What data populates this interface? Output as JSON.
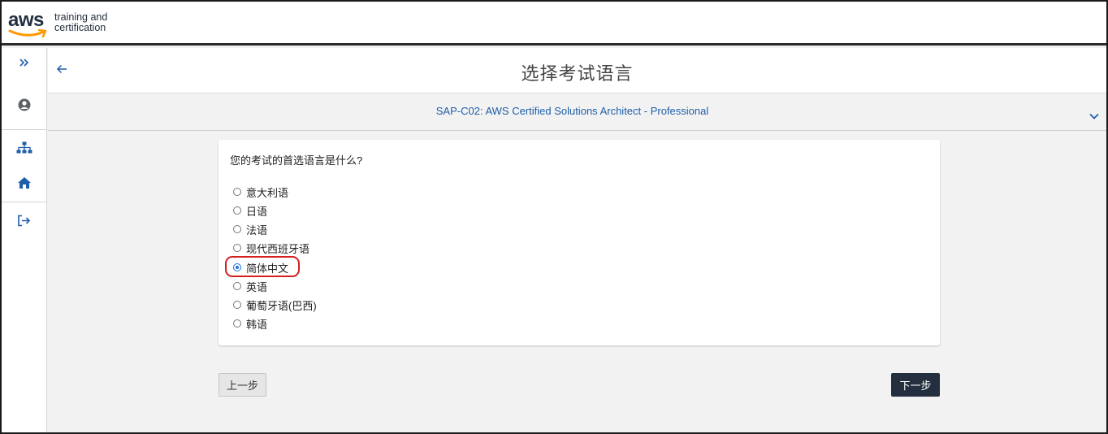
{
  "brand": {
    "logo_word": "aws",
    "logo_line1": "training and",
    "logo_line2": "certification"
  },
  "sidebar": {
    "items": [
      {
        "icon": "double-chevron-right-icon"
      },
      {
        "icon": "user-circle-icon"
      },
      {
        "icon": "sitemap-icon"
      },
      {
        "icon": "home-icon"
      },
      {
        "icon": "sign-out-icon"
      }
    ]
  },
  "header": {
    "title": "选择考试语言",
    "back_icon": "arrow-left-icon"
  },
  "exam": {
    "name": "SAP-C02: AWS Certified Solutions Architect - Professional",
    "toggle_icon": "chevron-down-icon"
  },
  "form": {
    "question": "您的考试的首选语言是什么?",
    "options": [
      {
        "label": "意大利语",
        "selected": false
      },
      {
        "label": "日语",
        "selected": false
      },
      {
        "label": "法语",
        "selected": false
      },
      {
        "label": "现代西班牙语",
        "selected": false
      },
      {
        "label": "简体中文",
        "selected": true
      },
      {
        "label": "英语",
        "selected": false
      },
      {
        "label": "葡萄牙语(巴西)",
        "selected": false
      },
      {
        "label": "韩语",
        "selected": false
      }
    ]
  },
  "buttons": {
    "prev": "上一步",
    "next": "下一步"
  },
  "colors": {
    "accent": "#1f5ea8",
    "primary_button": "#232f3e",
    "highlight": "#d42020",
    "aws_orange": "#ff9900"
  }
}
